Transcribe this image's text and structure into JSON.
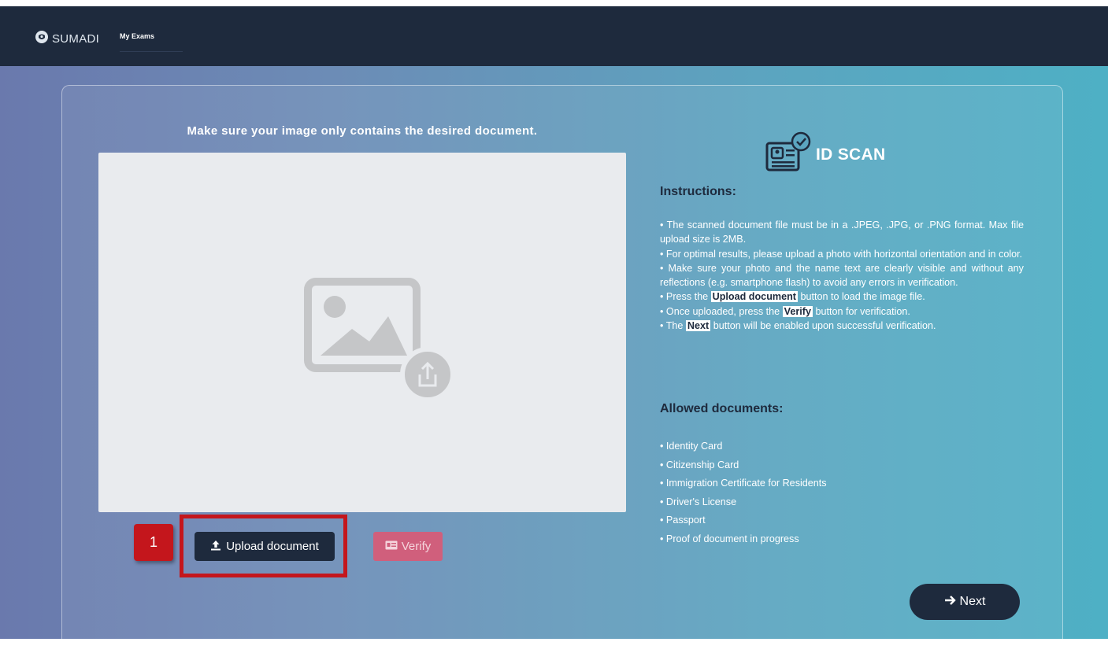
{
  "header": {
    "brand": "SUMADI",
    "nav_label": "My Exams"
  },
  "upload": {
    "title": "Make sure your image only contains the desired document.",
    "upload_button": "Upload document",
    "verify_button": "Verify",
    "step_number": "1"
  },
  "id_scan": {
    "title": "ID SCAN",
    "instructions_heading": "Instructions:",
    "instructions": [
      "The scanned document file must be in a .JPEG, .JPG, or .PNG format. Max file upload size is 2MB.",
      "For optimal results, please upload a photo with horizontal orientation and in color.",
      "Make sure your photo and the name text are clearly visible and without any reflections (e.g. smartphone flash) to avoid any errors in verification."
    ],
    "press_prefix": "Press the",
    "press_highlight": "Upload document",
    "press_suffix": "button to load the image file.",
    "once_prefix": "Once uploaded, press the",
    "once_highlight": "Verify",
    "once_suffix": "button for verification.",
    "next_prefix": "The",
    "next_highlight": "Next",
    "next_suffix": "button will be enabled upon successful verification.",
    "allowed_heading": "Allowed documents:",
    "allowed": [
      "Identity Card",
      "Citizenship Card",
      "Immigration Certificate for Residents",
      "Driver's License",
      "Passport",
      "Proof of document in progress"
    ]
  },
  "footer": {
    "next_button": "Next"
  },
  "icons": {
    "brand": "sumadi-logo-icon",
    "upload": "upload-icon",
    "verify": "id-card-icon",
    "next": "arrow-right-icon",
    "placeholder": "image-upload-placeholder-icon",
    "id_scan": "id-card-check-icon"
  },
  "colors": {
    "navy": "#1e2a3d",
    "verify_pink": "#d05f7c",
    "highlight_red": "#c4161c"
  }
}
